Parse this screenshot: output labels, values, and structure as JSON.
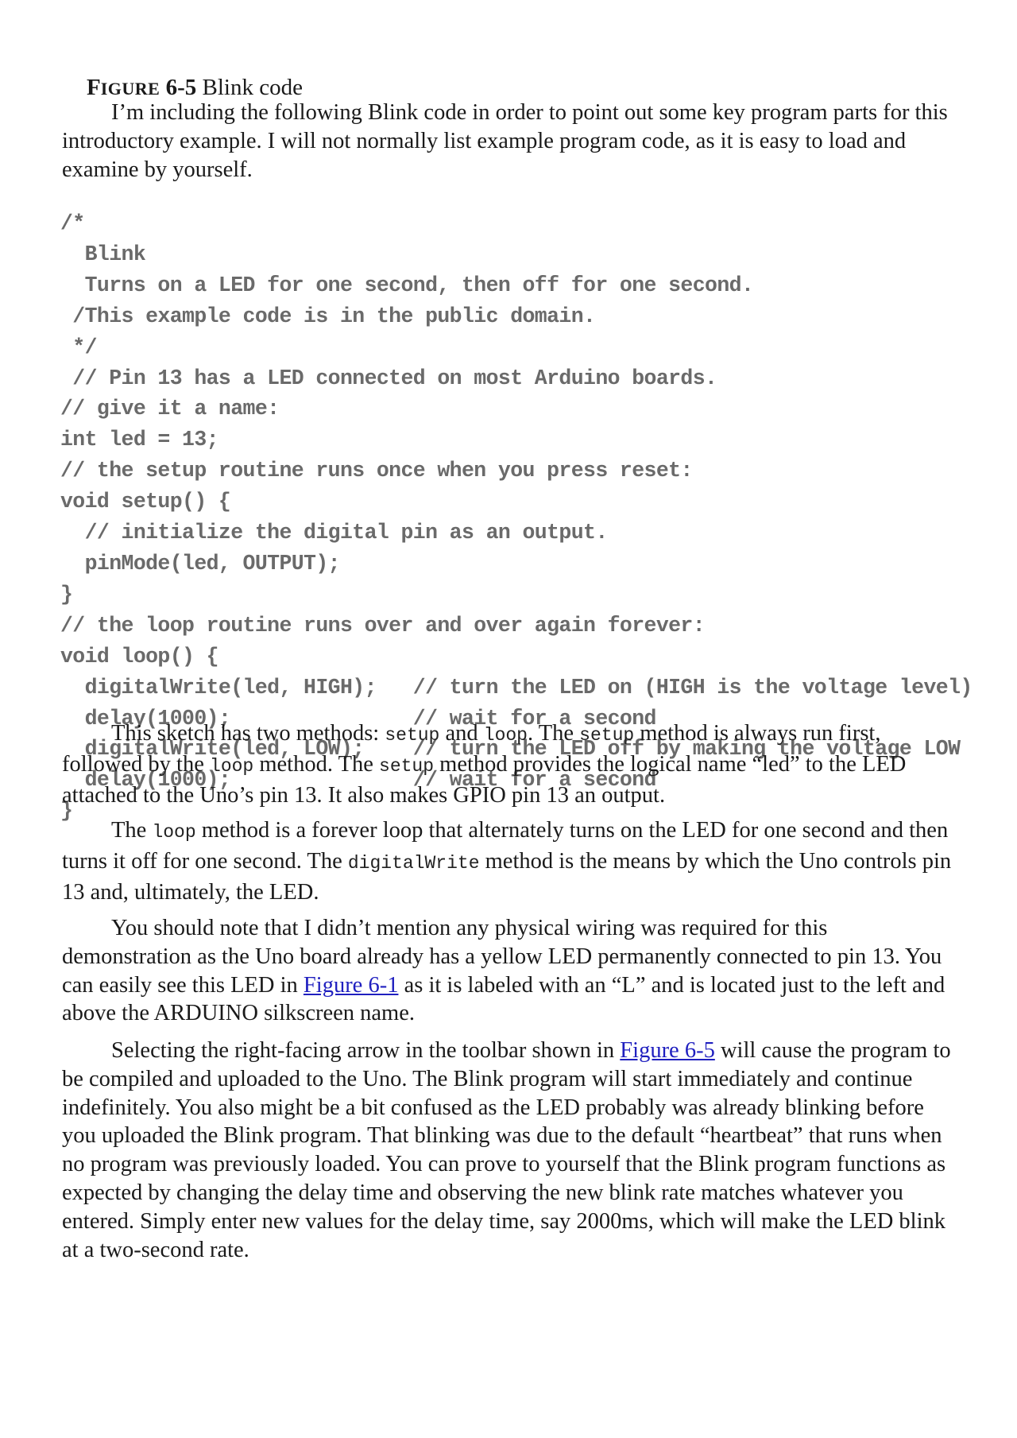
{
  "caption": {
    "label_first": "F",
    "label_rest": "IGURE",
    "number": "6-5",
    "title": "Blink code"
  },
  "intro_paragraph": "I’m including the following Blink code in order to point out some key program parts for this introductory example. I will not normally list example program code, as it is easy to load and examine by yourself.",
  "code_lines": [
    "/*",
    "  Blink",
    "  Turns on a LED for one second, then off for one second.",
    " /This example code is in the public domain.",
    " */",
    " // Pin 13 has a LED connected on most Arduino boards.",
    "// give it a name:",
    "int led = 13;",
    "// the setup routine runs once when you press reset:",
    "void setup() {",
    "  // initialize the digital pin as an output.",
    "  pinMode(led, OUTPUT);",
    "}",
    "// the loop routine runs over and over again forever:",
    "void loop() {",
    "  digitalWrite(led, HIGH);   // turn the LED on (HIGH is the voltage level)",
    "  delay(1000);               // wait for a second",
    "  digitalWrite(led, LOW);    // turn the LED off by making the voltage LOW",
    "  delay(1000);               // wait for a second",
    "}"
  ],
  "para_methods": {
    "t1": "This sketch has two methods: ",
    "c1": "setup",
    "t2": " and ",
    "c2": "loop",
    "t3": ". The ",
    "c3": "setup",
    "t4": " method is always run first, followed by the ",
    "c4": "loop",
    "t5": " method. The ",
    "c5": "setup",
    "t6": " method provides the logical name “led” to the LED attached to the Uno’s pin 13. It also makes GPIO pin 13 an output."
  },
  "para_loop": {
    "t1": "The ",
    "c1": "loop",
    "t2": " method is a forever loop that alternately turns on the LED for one second and then turns it off for one second. The ",
    "c2": "digitalWrite",
    "t3": " method is the means by which the Uno controls pin 13 and, ultimately, the LED."
  },
  "para_wiring": {
    "t1": "You should note that I didn’t mention any physical wiring was required for this demonstration as the Uno board already has a yellow LED permanently connected to pin 13. You can easily see this LED in ",
    "link": "Figure 6-1",
    "t2": " as it is labeled with an “L” and is located just to the left and above the ARDUINO silkscreen name."
  },
  "para_upload": {
    "t1": "Selecting the right-facing arrow in the toolbar shown in ",
    "link": "Figure 6-5",
    "t2": " will cause the program to be compiled and uploaded to the Uno. The Blink program will start immediately and continue indefinitely. You also might be a bit confused as the LED probably was already blinking before you uploaded the Blink program. That blinking was due to the default “heartbeat” that runs when no program was previously loaded. You can prove to yourself that the Blink program functions as expected by changing the delay time and observing the new blink rate matches whatever you entered. Simply enter new values for the delay time, say 2000ms, which will make the LED blink at a two-second rate."
  },
  "colors": {
    "text": "#1a1a1a",
    "code": "#6a6a6a",
    "link": "#1f1fbf"
  }
}
